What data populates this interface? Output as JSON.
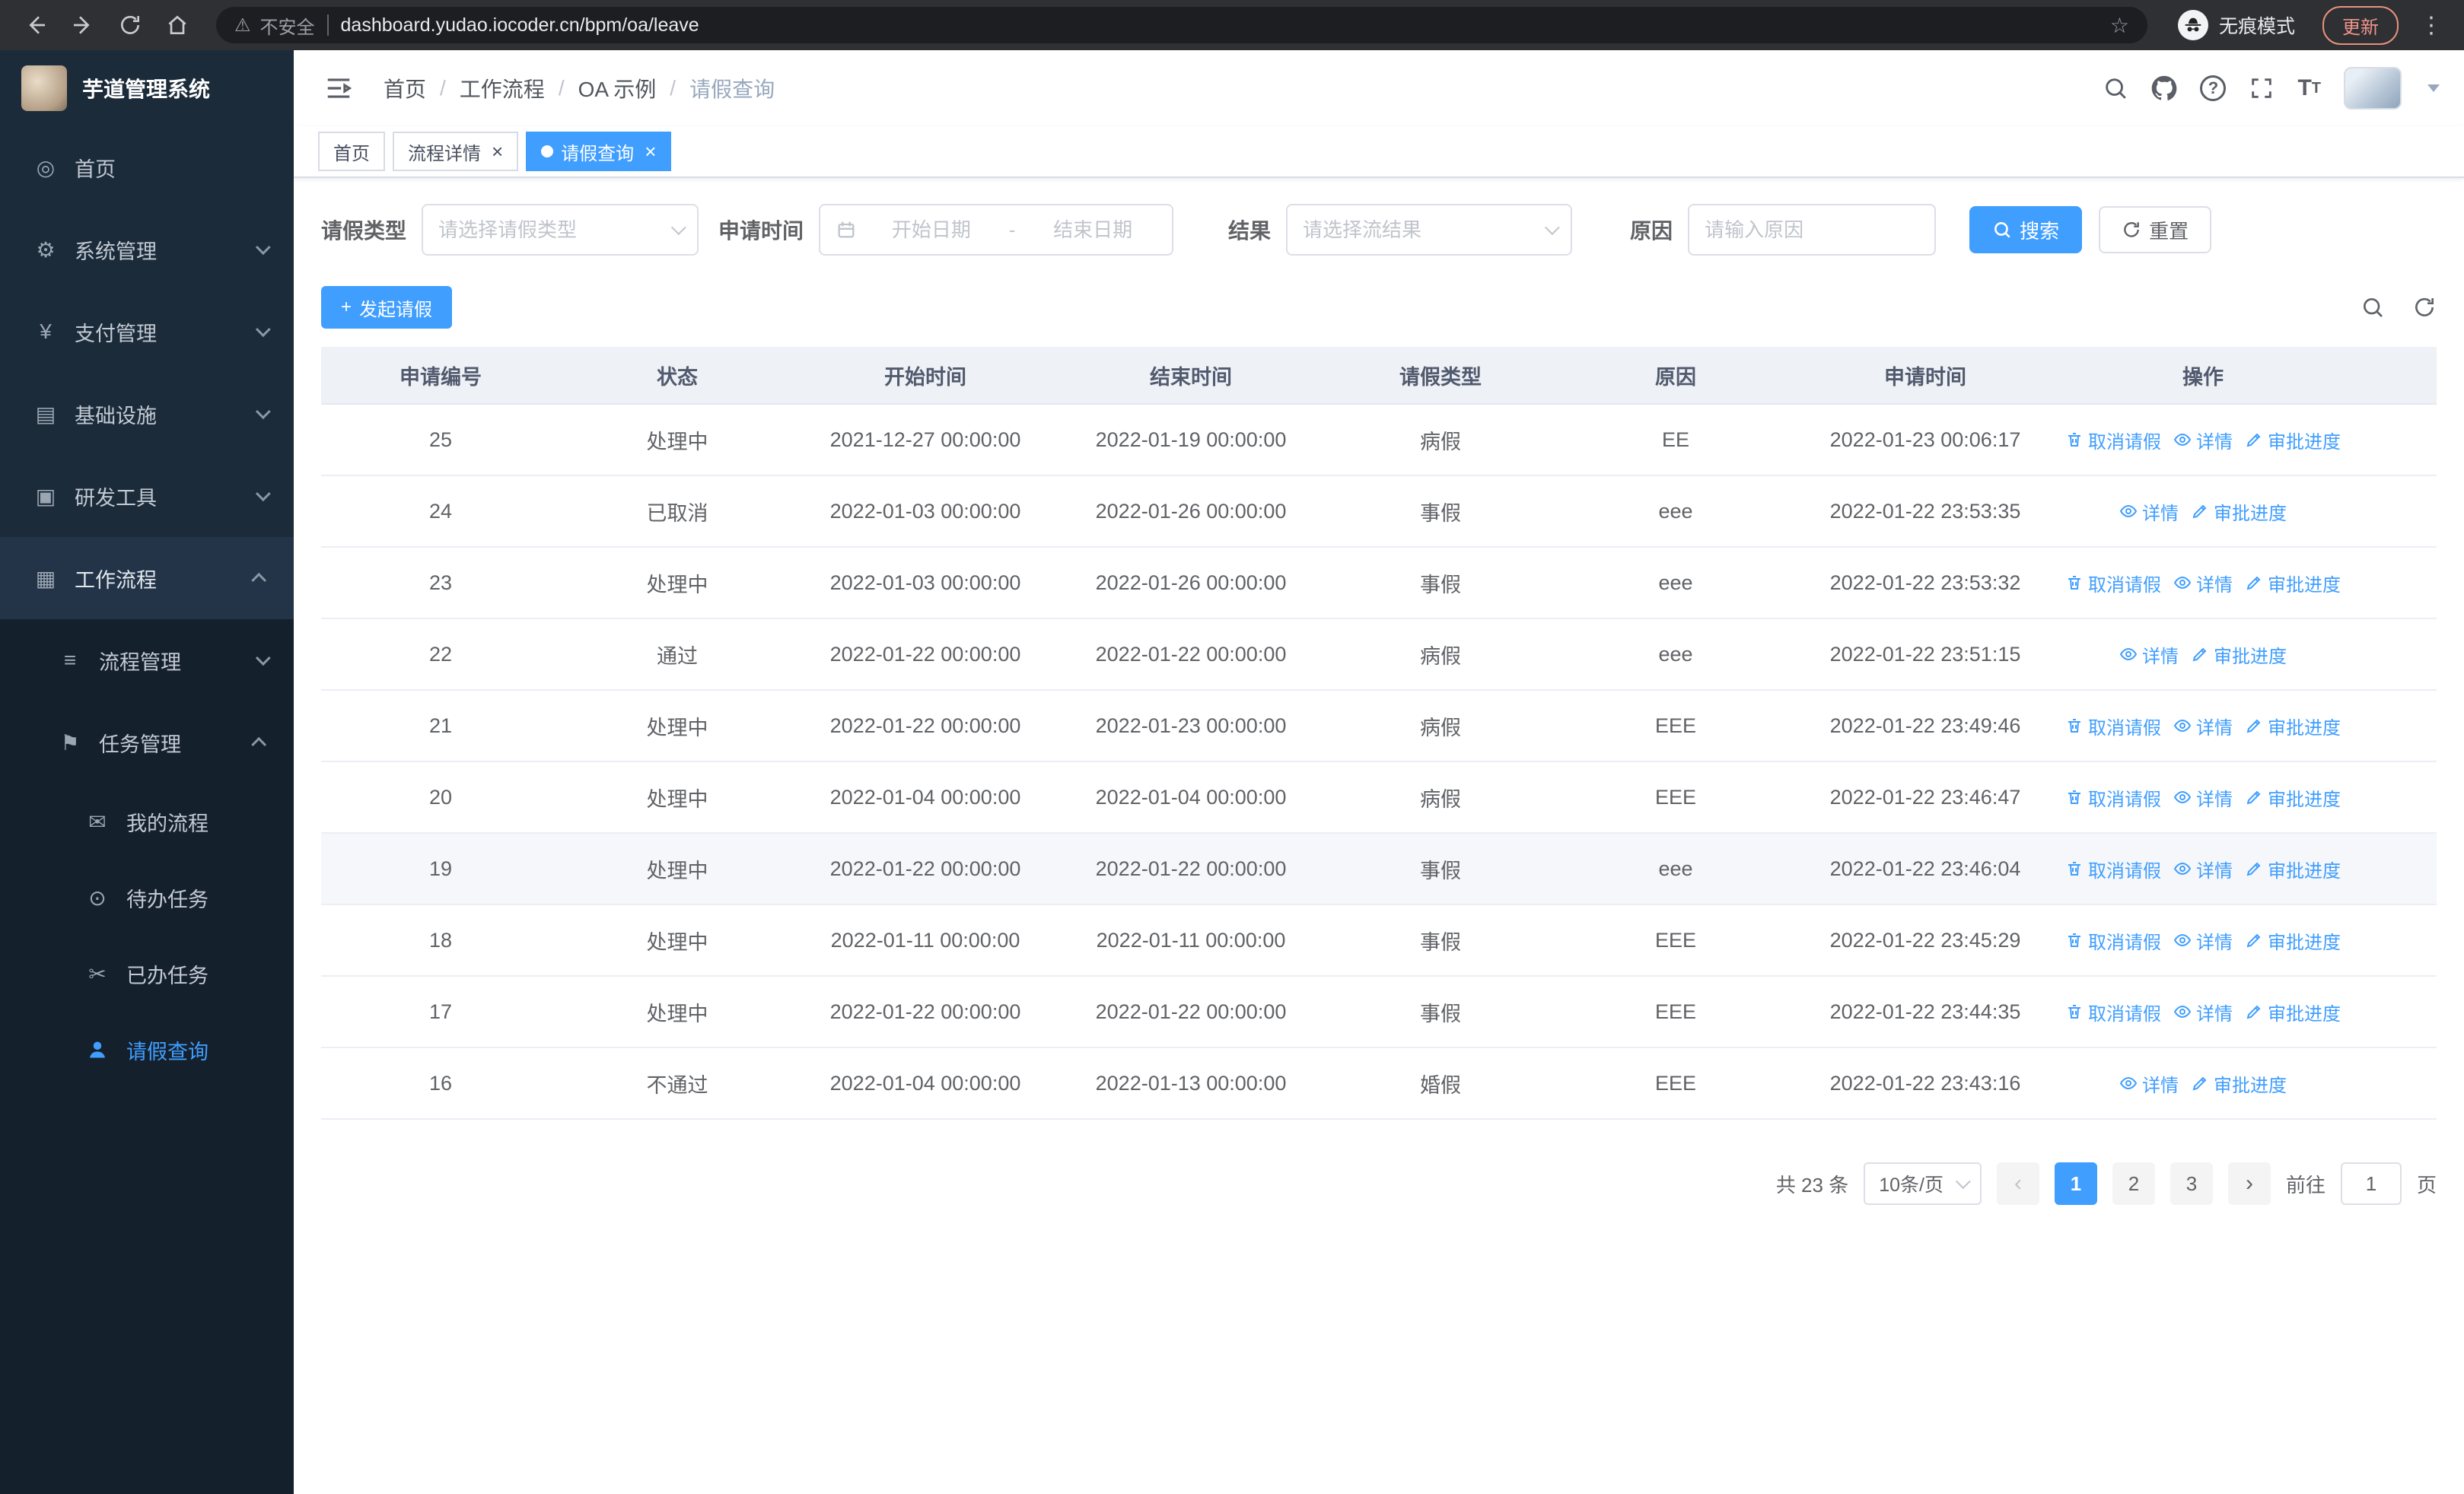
{
  "browser": {
    "security_label": "不安全",
    "url": "dashboard.yudao.iocoder.cn/bpm/oa/leave",
    "incognito_label": "无痕模式",
    "update_label": "更新"
  },
  "icons": {
    "home": "◎",
    "system": "⚙",
    "payment": "¥",
    "infrastructure": "▤",
    "devtools": "▣",
    "workflow": "▦",
    "process": "≡",
    "task": "⚑",
    "my_process": "✉",
    "pending": "⊙",
    "done": "✂"
  },
  "sidebar": {
    "app_title": "芋道管理系统",
    "items": {
      "home": "首页",
      "system": "系统管理",
      "payment": "支付管理",
      "infrastructure": "基础设施",
      "devtools": "研发工具",
      "workflow": "工作流程",
      "process_mgmt": "流程管理",
      "task_mgmt": "任务管理",
      "my_process": "我的流程",
      "pending_tasks": "待办任务",
      "done_tasks": "已办任务",
      "leave_query": "请假查询"
    }
  },
  "navbar": {
    "breadcrumb": [
      "首页",
      "工作流程",
      "OA 示例",
      "请假查询"
    ]
  },
  "tabs": [
    {
      "label": "首页"
    },
    {
      "label": "流程详情"
    },
    {
      "label": "请假查询"
    }
  ],
  "filters": {
    "leave_type_label": "请假类型",
    "leave_type_placeholder": "请选择请假类型",
    "apply_time_label": "申请时间",
    "start_date_placeholder": "开始日期",
    "range_separator": "-",
    "end_date_placeholder": "结束日期",
    "result_label": "结果",
    "result_placeholder": "请选择流结果",
    "reason_label": "原因",
    "reason_placeholder": "请输入原因",
    "search_button": "搜索",
    "reset_button": "重置"
  },
  "toolbar": {
    "create_button": "发起请假"
  },
  "table": {
    "columns": [
      "申请编号",
      "状态",
      "开始时间",
      "结束时间",
      "请假类型",
      "原因",
      "申请时间",
      "操作"
    ],
    "action_labels": {
      "cancel": "取消请假",
      "detail": "详情",
      "progress": "审批进度"
    },
    "rows": [
      {
        "id": "25",
        "status": "处理中",
        "start": "2021-12-27 00:00:00",
        "end": "2022-01-19 00:00:00",
        "type": "病假",
        "reason": "EE",
        "applied": "2022-01-23 00:06:17",
        "actions": [
          "cancel",
          "detail",
          "progress"
        ]
      },
      {
        "id": "24",
        "status": "已取消",
        "start": "2022-01-03 00:00:00",
        "end": "2022-01-26 00:00:00",
        "type": "事假",
        "reason": "eee",
        "applied": "2022-01-22 23:53:35",
        "actions": [
          "detail",
          "progress"
        ]
      },
      {
        "id": "23",
        "status": "处理中",
        "start": "2022-01-03 00:00:00",
        "end": "2022-01-26 00:00:00",
        "type": "事假",
        "reason": "eee",
        "applied": "2022-01-22 23:53:32",
        "actions": [
          "cancel",
          "detail",
          "progress"
        ]
      },
      {
        "id": "22",
        "status": "通过",
        "start": "2022-01-22 00:00:00",
        "end": "2022-01-22 00:00:00",
        "type": "病假",
        "reason": "eee",
        "applied": "2022-01-22 23:51:15",
        "actions": [
          "detail",
          "progress"
        ]
      },
      {
        "id": "21",
        "status": "处理中",
        "start": "2022-01-22 00:00:00",
        "end": "2022-01-23 00:00:00",
        "type": "病假",
        "reason": "EEE",
        "applied": "2022-01-22 23:49:46",
        "actions": [
          "cancel",
          "detail",
          "progress"
        ]
      },
      {
        "id": "20",
        "status": "处理中",
        "start": "2022-01-04 00:00:00",
        "end": "2022-01-04 00:00:00",
        "type": "病假",
        "reason": "EEE",
        "applied": "2022-01-22 23:46:47",
        "actions": [
          "cancel",
          "detail",
          "progress"
        ]
      },
      {
        "id": "19",
        "status": "处理中",
        "start": "2022-01-22 00:00:00",
        "end": "2022-01-22 00:00:00",
        "type": "事假",
        "reason": "eee",
        "applied": "2022-01-22 23:46:04",
        "actions": [
          "cancel",
          "detail",
          "progress"
        ],
        "highlight": true
      },
      {
        "id": "18",
        "status": "处理中",
        "start": "2022-01-11 00:00:00",
        "end": "2022-01-11 00:00:00",
        "type": "事假",
        "reason": "EEE",
        "applied": "2022-01-22 23:45:29",
        "actions": [
          "cancel",
          "detail",
          "progress"
        ]
      },
      {
        "id": "17",
        "status": "处理中",
        "start": "2022-01-22 00:00:00",
        "end": "2022-01-22 00:00:00",
        "type": "事假",
        "reason": "EEE",
        "applied": "2022-01-22 23:44:35",
        "actions": [
          "cancel",
          "detail",
          "progress"
        ]
      },
      {
        "id": "16",
        "status": "不通过",
        "start": "2022-01-04 00:00:00",
        "end": "2022-01-13 00:00:00",
        "type": "婚假",
        "reason": "EEE",
        "applied": "2022-01-22 23:43:16",
        "actions": [
          "detail",
          "progress"
        ]
      }
    ]
  },
  "pagination": {
    "total_text": "共 23 条",
    "page_size": "10条/页",
    "pages": [
      "1",
      "2",
      "3"
    ],
    "active_page": "1",
    "goto_label": "前往",
    "goto_value": "1",
    "page_suffix": "页"
  },
  "colors": {
    "primary": "#409eff",
    "sidebar_bg": "#1c2b3a",
    "submenu_bg": "#15202d"
  }
}
